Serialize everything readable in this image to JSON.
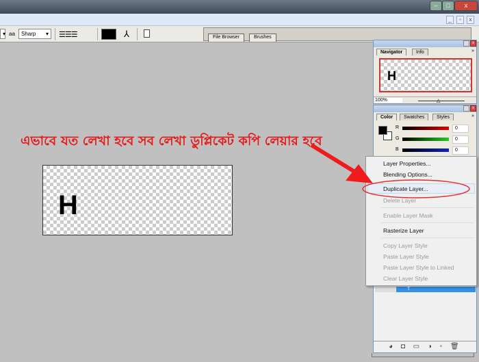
{
  "window": {
    "minimize": "–",
    "maximize": "□",
    "close": "x"
  },
  "doc_controls": {
    "minimize": "_",
    "restore": "▫",
    "close": "x"
  },
  "toolbar": {
    "antialias_icon": "aa",
    "antialias_value": "Sharp",
    "warp_icon": "warp-text-icon",
    "palette_icon": "palettes-icon"
  },
  "well_tabs": [
    "File Browser",
    "Brushes"
  ],
  "navigator": {
    "tabs": [
      "Navigator",
      "Info"
    ],
    "preview_letter": "H",
    "zoom": "100%",
    "menu": "»"
  },
  "color": {
    "tabs": [
      "Color",
      "Swatches",
      "Styles"
    ],
    "menu": "»",
    "channels": [
      {
        "label": "R",
        "value": "0"
      },
      {
        "label": "G",
        "value": "0"
      },
      {
        "label": "B",
        "value": "0"
      }
    ]
  },
  "canvas": {
    "letter": "H"
  },
  "annotation": {
    "text": "এভাবে যত লেখা হবে সব লেখা ডুপ্লিকেট কপি লেয়ার হবে",
    "color": "#e41b1b"
  },
  "context_menu": {
    "items": [
      {
        "label": "Layer Properties...",
        "disabled": false
      },
      {
        "label": "Blending Options...",
        "disabled": false
      },
      {
        "label": "Duplicate Layer...",
        "disabled": false
      },
      {
        "label": "Delete Layer",
        "disabled": true
      },
      {
        "label": "Enable Layer Mask",
        "disabled": true
      },
      {
        "label": "Rasterize Layer",
        "disabled": false
      },
      {
        "label": "Copy Layer Style",
        "disabled": true
      },
      {
        "label": "Paste Layer Style",
        "disabled": true
      },
      {
        "label": "Paste Layer Style to Linked",
        "disabled": true
      },
      {
        "label": "Clear Layer Style",
        "disabled": true
      }
    ]
  },
  "layers": {
    "selected_layer": "T"
  }
}
